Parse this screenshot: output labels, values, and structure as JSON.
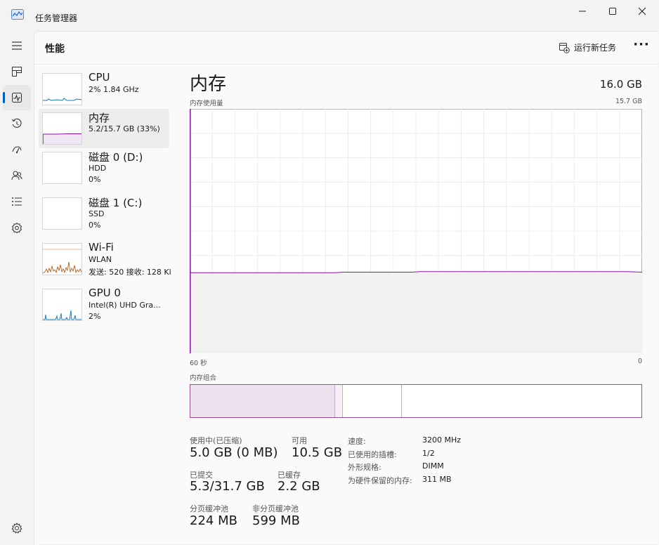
{
  "app": {
    "title": "任务管理器",
    "window_buttons": [
      "minimize",
      "maximize",
      "close"
    ]
  },
  "nav": {
    "items": [
      {
        "icon": "hamburger-menu-icon"
      },
      {
        "icon": "processes-icon"
      },
      {
        "icon": "performance-icon",
        "active": true
      },
      {
        "icon": "app-history-icon"
      },
      {
        "icon": "startup-apps-icon"
      },
      {
        "icon": "users-icon"
      },
      {
        "icon": "details-icon"
      },
      {
        "icon": "services-icon"
      }
    ],
    "settings_icon": "settings-icon"
  },
  "header": {
    "title": "性能",
    "run_new_task_label": "运行新任务",
    "more_label": "···"
  },
  "devices": [
    {
      "name": "CPU",
      "line1": "2%  1.84 GHz",
      "line2": "",
      "color": "#117dbb"
    },
    {
      "name": "内存",
      "line1": "5.2/15.7 GB (33%)",
      "line2": "",
      "color": "#8b12ae",
      "selected": true
    },
    {
      "name": "磁盘 0 (D:)",
      "line1": "HDD",
      "line2": "0%",
      "color": "#4da60c"
    },
    {
      "name": "磁盘 1 (C:)",
      "line1": "SSD",
      "line2": "0%",
      "color": "#4da60c"
    },
    {
      "name": "Wi-Fi",
      "line1": "WLAN",
      "line2": "发送: 520  接收: 128 Kl",
      "color": "#a74f01"
    },
    {
      "name": "GPU 0",
      "line1": "Intel(R) UHD Gra...",
      "line2": "2%",
      "color": "#117dbb"
    }
  ],
  "memory": {
    "title": "内存",
    "total": "16.0 GB",
    "usage_caption": "内存使用量",
    "max_caption": "15.7 GB",
    "time_left": "60 秒",
    "time_right": "0",
    "composition_caption": "内存组合",
    "usage_series": [
      0.33,
      0.33,
      0.33,
      0.33,
      0.33,
      0.33,
      0.33,
      0.33,
      0.33,
      0.33,
      0.33,
      0.33,
      0.33,
      0.33,
      0.33,
      0.33,
      0.33,
      0.33,
      0.33,
      0.33,
      0.332,
      0.332,
      0.332,
      0.332,
      0.332,
      0.332,
      0.332,
      0.332,
      0.332,
      0.332,
      0.334,
      0.334,
      0.334,
      0.334,
      0.334,
      0.334,
      0.334,
      0.334,
      0.334,
      0.334,
      0.334,
      0.334,
      0.334,
      0.334,
      0.334,
      0.334,
      0.334,
      0.334,
      0.334,
      0.334,
      0.334,
      0.334,
      0.334,
      0.334,
      0.334,
      0.334,
      0.334,
      0.334,
      0.333,
      0.332
    ],
    "composition": {
      "in_use_fraction": 0.32,
      "modified_fraction": 0.015,
      "standby_fraction": 0.13
    },
    "stats": {
      "in_use_label": "使用中(已压缩)",
      "in_use_value": "5.0 GB (0 MB)",
      "available_label": "可用",
      "available_value": "10.5 GB",
      "committed_label": "已提交",
      "committed_value": "5.3/31.7 GB",
      "cached_label": "已缓存",
      "cached_value": "2.2 GB",
      "paged_pool_label": "分页缓冲池",
      "paged_pool_value": "224 MB",
      "nonpaged_pool_label": "非分页缓冲池",
      "nonpaged_pool_value": "599 MB"
    },
    "specs": [
      {
        "key": "速度:",
        "value": "3200 MHz"
      },
      {
        "key": "已使用的插槽:",
        "value": "1/2"
      },
      {
        "key": "外形规格:",
        "value": "DIMM"
      },
      {
        "key": "为硬件保留的内存:",
        "value": "311 MB"
      }
    ],
    "color": "#8b12ae"
  }
}
